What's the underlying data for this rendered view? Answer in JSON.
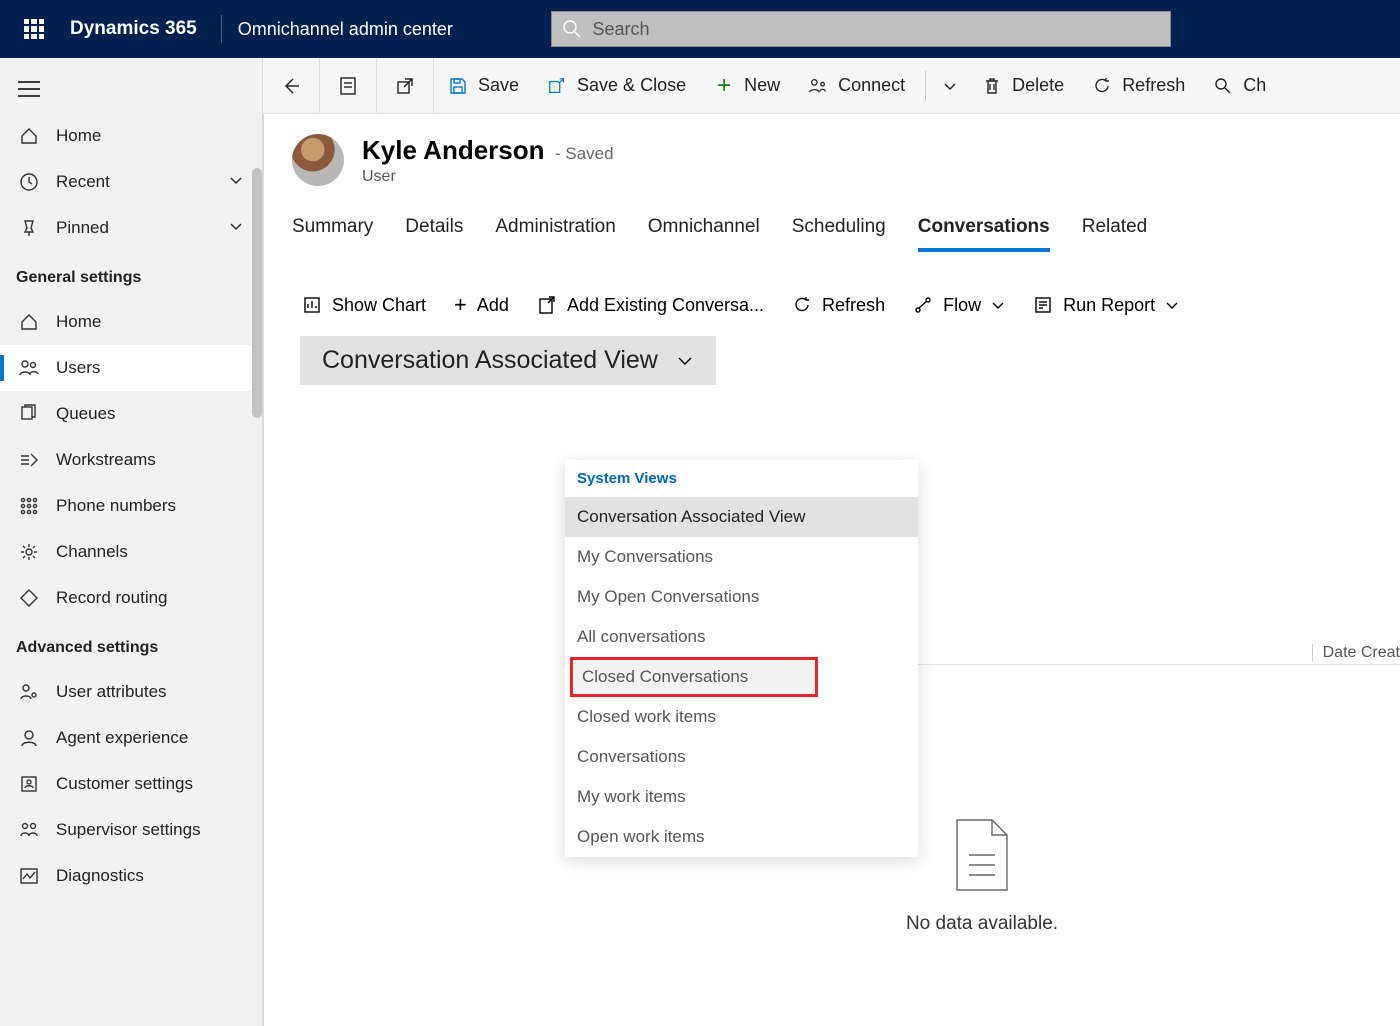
{
  "header": {
    "brand": "Dynamics 365",
    "app_name": "Omnichannel admin center",
    "search_placeholder": "Search"
  },
  "sidebar": {
    "items": [
      {
        "label": "Home",
        "icon": "home"
      },
      {
        "label": "Recent",
        "icon": "clock",
        "expandable": true
      },
      {
        "label": "Pinned",
        "icon": "pin",
        "expandable": true
      }
    ],
    "groups": [
      {
        "title": "General settings",
        "items": [
          {
            "label": "Home",
            "icon": "home"
          },
          {
            "label": "Users",
            "icon": "users",
            "active": true
          },
          {
            "label": "Queues",
            "icon": "queues"
          },
          {
            "label": "Workstreams",
            "icon": "workstream"
          },
          {
            "label": "Phone numbers",
            "icon": "dialpad"
          },
          {
            "label": "Channels",
            "icon": "gear"
          },
          {
            "label": "Record routing",
            "icon": "diamond"
          }
        ]
      },
      {
        "title": "Advanced settings",
        "items": [
          {
            "label": "User attributes",
            "icon": "userattr"
          },
          {
            "label": "Agent experience",
            "icon": "agent"
          },
          {
            "label": "Customer settings",
            "icon": "customer"
          },
          {
            "label": "Supervisor settings",
            "icon": "supervisor"
          },
          {
            "label": "Diagnostics",
            "icon": "diag"
          }
        ]
      }
    ]
  },
  "commandbar": {
    "back": "Back",
    "save": "Save",
    "save_close": "Save & Close",
    "new": "New",
    "connect": "Connect",
    "delete": "Delete",
    "refresh": "Refresh",
    "check": "Ch"
  },
  "record": {
    "name": "Kyle Anderson",
    "status_suffix": "- Saved",
    "entity": "User"
  },
  "tabs": [
    {
      "label": "Summary"
    },
    {
      "label": "Details"
    },
    {
      "label": "Administration"
    },
    {
      "label": "Omnichannel"
    },
    {
      "label": "Scheduling"
    },
    {
      "label": "Conversations",
      "active": true
    },
    {
      "label": "Related"
    }
  ],
  "subcommands": {
    "show_chart": "Show Chart",
    "add": "Add",
    "add_existing": "Add Existing Conversa...",
    "refresh": "Refresh",
    "flow": "Flow",
    "run_report": "Run Report"
  },
  "view": {
    "title": "Conversation Associated View",
    "system_views_label": "System Views",
    "options": [
      "Conversation Associated View",
      "My Conversations",
      "My Open Conversations",
      "All conversations",
      "Closed Conversations",
      "Closed work items",
      "Conversations",
      "My work items",
      "Open work items"
    ],
    "selected_index": 0,
    "highlighted_index": 4
  },
  "grid": {
    "date_column": "Date Creat",
    "empty_message": "No data available."
  }
}
